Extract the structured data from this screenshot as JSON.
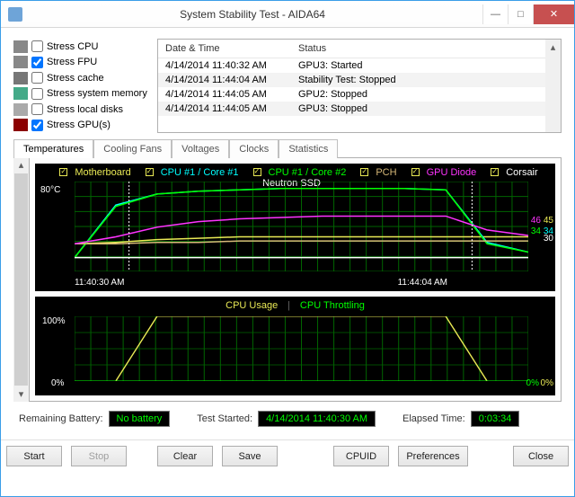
{
  "window": {
    "title": "System Stability Test - AIDA64"
  },
  "stress": {
    "items": [
      {
        "label": "Stress CPU",
        "checked": false,
        "icon": "cpu"
      },
      {
        "label": "Stress FPU",
        "checked": true,
        "icon": "fpu"
      },
      {
        "label": "Stress cache",
        "checked": false,
        "icon": "cache"
      },
      {
        "label": "Stress system memory",
        "checked": false,
        "icon": "mem"
      },
      {
        "label": "Stress local disks",
        "checked": false,
        "icon": "disk"
      },
      {
        "label": "Stress GPU(s)",
        "checked": true,
        "icon": "gpu"
      }
    ]
  },
  "log": {
    "hdr_date": "Date & Time",
    "hdr_status": "Status",
    "rows": [
      {
        "dt": "4/14/2014 11:40:32 AM",
        "st": "GPU3: Started"
      },
      {
        "dt": "4/14/2014 11:44:04 AM",
        "st": "Stability Test: Stopped"
      },
      {
        "dt": "4/14/2014 11:44:05 AM",
        "st": "GPU2: Stopped"
      },
      {
        "dt": "4/14/2014 11:44:05 AM",
        "st": "GPU3: Stopped"
      }
    ]
  },
  "tabs": {
    "items": [
      "Temperatures",
      "Cooling Fans",
      "Voltages",
      "Clocks",
      "Statistics"
    ],
    "active": 0
  },
  "chart_data": [
    {
      "type": "line",
      "title": "",
      "ylabel": "°C",
      "ylim": [
        20,
        85
      ],
      "x_start": "11:40:30 AM",
      "x_end": "11:44:04 AM",
      "y_tick": "80°C",
      "legend": [
        {
          "name": "Motherboard",
          "color": "#e9e955",
          "checked": true
        },
        {
          "name": "CPU #1 / Core #1",
          "color": "#00ffff",
          "checked": true
        },
        {
          "name": "CPU #1 / Core #2",
          "color": "#00ff00",
          "checked": true
        },
        {
          "name": "PCH",
          "color": "#d6b878",
          "checked": true
        },
        {
          "name": "GPU Diode",
          "color": "#ff33ff",
          "checked": true
        },
        {
          "name": "Corsair Neutron SSD",
          "color": "#ffffff",
          "checked": true
        }
      ],
      "end_labels": [
        {
          "value": 45,
          "color": "#e9e955"
        },
        {
          "value": 46,
          "color": "#ff33ff"
        },
        {
          "value": 34,
          "color": "#00ffff"
        },
        {
          "value": 34,
          "color": "#00ff00"
        },
        {
          "value": 30,
          "color": "#ffffff"
        }
      ],
      "series": [
        {
          "name": "Motherboard",
          "values": [
            40,
            41,
            43,
            44,
            45,
            45,
            45,
            45,
            45,
            45,
            45,
            45
          ]
        },
        {
          "name": "CPU #1 / Core #1",
          "values": [
            30,
            68,
            76,
            78,
            79,
            80,
            80,
            80,
            80,
            79,
            41,
            34
          ]
        },
        {
          "name": "CPU #1 / Core #2",
          "values": [
            30,
            67,
            76,
            78,
            79,
            80,
            80,
            80,
            80,
            79,
            40,
            34
          ]
        },
        {
          "name": "PCH",
          "values": [
            40,
            40,
            41,
            41,
            42,
            42,
            42,
            42,
            42,
            42,
            42,
            42
          ]
        },
        {
          "name": "GPU Diode",
          "values": [
            40,
            45,
            52,
            56,
            58,
            59,
            60,
            60,
            60,
            60,
            50,
            46
          ]
        },
        {
          "name": "Corsair Neutron SSD",
          "values": [
            30,
            30,
            30,
            30,
            30,
            30,
            30,
            30,
            30,
            30,
            30,
            30
          ]
        }
      ]
    },
    {
      "type": "line",
      "title": "",
      "ylim": [
        0,
        100
      ],
      "y_ticks": [
        "100%",
        "0%"
      ],
      "legend": [
        {
          "name": "CPU Usage",
          "color": "#e9e955"
        },
        {
          "name": "CPU Throttling",
          "color": "#00ff00"
        }
      ],
      "end_labels": [
        {
          "value": "0%",
          "color": "#e9e955"
        },
        {
          "value": "0%",
          "color": "#00ff00"
        }
      ],
      "series": [
        {
          "name": "CPU Usage",
          "values": [
            0,
            0,
            100,
            100,
            100,
            100,
            100,
            100,
            100,
            100,
            0,
            0
          ]
        },
        {
          "name": "CPU Throttling",
          "values": [
            0,
            0,
            0,
            0,
            0,
            0,
            0,
            0,
            0,
            0,
            0,
            0
          ]
        }
      ]
    }
  ],
  "status": {
    "battery_label": "Remaining Battery:",
    "battery_value": "No battery",
    "started_label": "Test Started:",
    "started_value": "4/14/2014 11:40:30 AM",
    "elapsed_label": "Elapsed Time:",
    "elapsed_value": "0:03:34"
  },
  "buttons": {
    "start": "Start",
    "stop": "Stop",
    "clear": "Clear",
    "save": "Save",
    "cpuid": "CPUID",
    "prefs": "Preferences",
    "close": "Close"
  }
}
